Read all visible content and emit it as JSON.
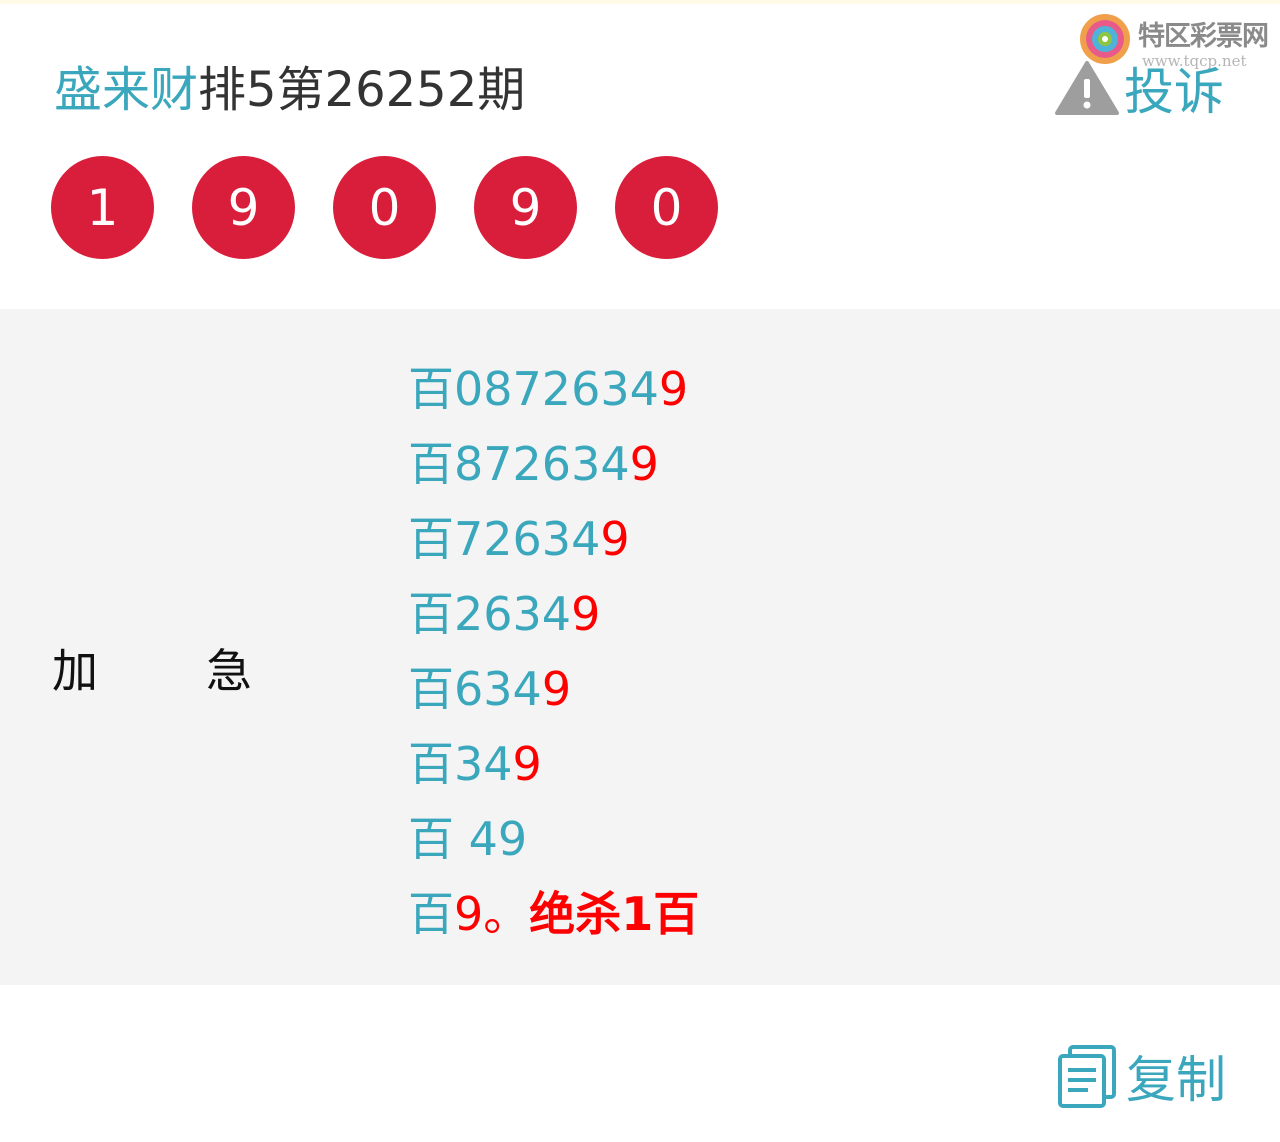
{
  "header": {
    "author": "盛来财",
    "issue": "排5第26252期",
    "complain_label": "投诉"
  },
  "watermark": {
    "name": "特区彩票网",
    "url": "www.tqcp.net"
  },
  "balls": [
    "1",
    "9",
    "0",
    "9",
    "0"
  ],
  "category": {
    "left": "加",
    "right": "急"
  },
  "lines": [
    {
      "prefix": "百",
      "teal": "0872634",
      "red": "9"
    },
    {
      "prefix": "百",
      "teal": "872634",
      "red": "9"
    },
    {
      "prefix": "百",
      "teal": "72634",
      "red": "9"
    },
    {
      "prefix": "百",
      "teal": "2634",
      "red": "9"
    },
    {
      "prefix": "百",
      "teal": "634",
      "red": "9"
    },
    {
      "prefix": "百",
      "teal": "34",
      "red": "9"
    },
    {
      "prefix": "百",
      "teal": " 49",
      "red": ""
    },
    {
      "prefix": "百",
      "teal": "",
      "red": "9。",
      "strong": "绝杀1百"
    }
  ],
  "footer": {
    "copy_label": "复制"
  },
  "colors": {
    "accent": "#3aa7bd",
    "ball": "#d91e3b",
    "highlight": "#ff0000",
    "panel": "#f4f4f4"
  }
}
